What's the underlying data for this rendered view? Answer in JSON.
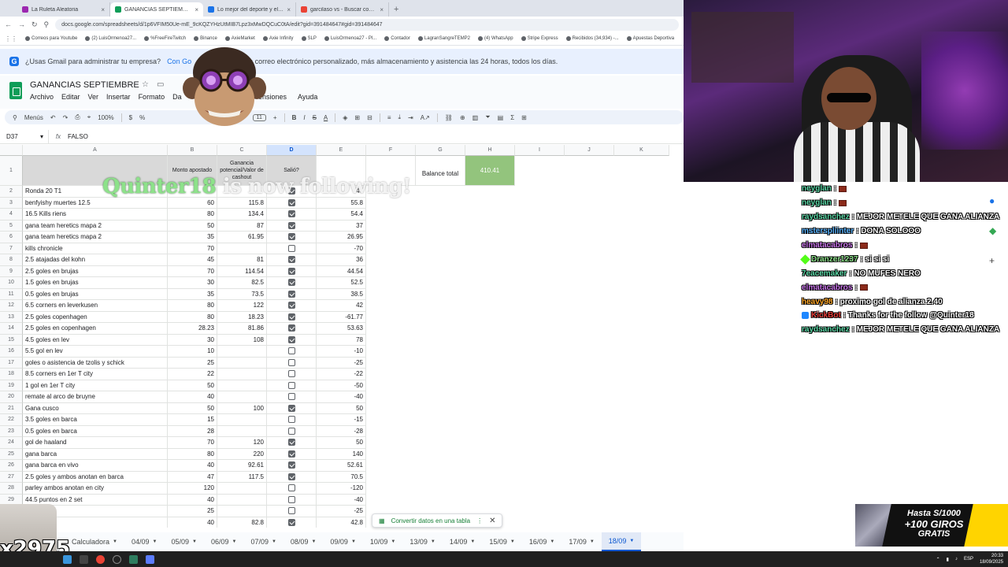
{
  "browser": {
    "tabs": [
      {
        "title": "La Ruleta Aleatoria",
        "color": "#9c27b0",
        "active": false
      },
      {
        "title": "GANANCIAS SEPTIEMBRE - Hojas",
        "color": "#0f9d58",
        "active": true
      },
      {
        "title": "Lo mejor del deporte y el entre",
        "color": "#1a73e8",
        "active": false
      },
      {
        "title": "garcilaso vs - Buscar con Goog",
        "color": "#ea4335",
        "active": false
      }
    ],
    "url": "docs.google.com/spreadsheets/d/1p6VFIM50Ue-mE_9cKQZYHzUtMIB7Lpz3xMwDQCuC0tA/edit?gid=391484647#gid=391484647",
    "bookmarks": [
      "Correos para Youtube",
      "(2) LuisOrmenoa27...",
      "%FreeFireTwitch",
      "Binance",
      "AxieMarket",
      "Axie Infinity",
      "SLP",
      "LuisOrmenoa27 - Pl...",
      "Contador",
      "LagranSangreTEMP2",
      "(4) WhatsApp",
      "Stripe Express",
      "Recibidos (34,934) -...",
      "Apuestas Deportiva"
    ]
  },
  "banner": {
    "icon": "G",
    "text": "¿Usas Gmail para administrar tu empresa?",
    "link": "Con Go",
    "rest": "un correo electrónico personalizado, más almacenamiento y asistencia las 24 horas, todos los días."
  },
  "sheet": {
    "title": "GANANCIAS SEPTIEMBRE",
    "menus": [
      "Archivo",
      "Editar",
      "Ver",
      "Insertar",
      "Formato",
      "Da"
    ],
    "menu_ext": "ensiones",
    "menu_help": "Ayuda",
    "toolbar": {
      "menus": "Menús",
      "zoom": "100%",
      "currency": "$",
      "percent": "%",
      "font": "Calibri",
      "size": "11"
    },
    "namebox": "D37",
    "formula": "FALSO",
    "columns": [
      "A",
      "B",
      "C",
      "D",
      "E",
      "F",
      "G",
      "H",
      "I",
      "J",
      "K"
    ],
    "header_row": {
      "a": "",
      "b": "Monto apostado",
      "c": "Ganancia potencial/Valor de cashout",
      "d": "Salió?",
      "g": "Balance total",
      "h": "410.41"
    },
    "rows": [
      {
        "n": "2",
        "a": "Ronda 20 T1",
        "b": "",
        "c": "",
        "d": true,
        "e": "48"
      },
      {
        "n": "3",
        "a": "benfyishy muertes 12.5",
        "b": "60",
        "c": "115.8",
        "d": true,
        "e": "55.8"
      },
      {
        "n": "4",
        "a": "16.5 Kills riens",
        "b": "80",
        "c": "134.4",
        "d": true,
        "e": "54.4"
      },
      {
        "n": "5",
        "a": "gana team heretics mapa 2",
        "b": "50",
        "c": "87",
        "d": true,
        "e": "37"
      },
      {
        "n": "6",
        "a": "gana team heretics mapa 2",
        "b": "35",
        "c": "61.95",
        "d": true,
        "e": "26.95"
      },
      {
        "n": "7",
        "a": "kills chronicle",
        "b": "70",
        "c": "",
        "d": false,
        "e": "-70"
      },
      {
        "n": "8",
        "a": "2.5 atajadas del kohn",
        "b": "45",
        "c": "81",
        "d": true,
        "e": "36"
      },
      {
        "n": "9",
        "a": "2.5 goles en brujas",
        "b": "70",
        "c": "114.54",
        "d": true,
        "e": "44.54"
      },
      {
        "n": "10",
        "a": "1.5 goles en brujas",
        "b": "30",
        "c": "82.5",
        "d": true,
        "e": "52.5"
      },
      {
        "n": "11",
        "a": "0.5 goles en brujas",
        "b": "35",
        "c": "73.5",
        "d": true,
        "e": "38.5"
      },
      {
        "n": "12",
        "a": "6.5 corners en leverkusen",
        "b": "80",
        "c": "122",
        "d": true,
        "e": "42"
      },
      {
        "n": "13",
        "a": "2.5 goles copenhagen",
        "b": "80",
        "c": "18.23",
        "d": true,
        "e": "-61.77"
      },
      {
        "n": "14",
        "a": "2.5 goles en copenhagen",
        "b": "28.23",
        "c": "81.86",
        "d": true,
        "e": "53.63"
      },
      {
        "n": "15",
        "a": "4.5 goles en lev",
        "b": "30",
        "c": "108",
        "d": true,
        "e": "78"
      },
      {
        "n": "16",
        "a": "5.5 gol en lev",
        "b": "10",
        "c": "",
        "d": false,
        "e": "-10"
      },
      {
        "n": "17",
        "a": "goles o asistencia de tzolis y schick",
        "b": "25",
        "c": "",
        "d": false,
        "e": "-25"
      },
      {
        "n": "18",
        "a": "8.5 corners en 1er T city",
        "b": "22",
        "c": "",
        "d": false,
        "e": "-22"
      },
      {
        "n": "19",
        "a": "1 gol en 1er T city",
        "b": "50",
        "c": "",
        "d": false,
        "e": "-50"
      },
      {
        "n": "20",
        "a": "remate al arco de bruyne",
        "b": "40",
        "c": "",
        "d": false,
        "e": "-40"
      },
      {
        "n": "21",
        "a": "Gana cusco",
        "b": "50",
        "c": "100",
        "d": true,
        "e": "50"
      },
      {
        "n": "22",
        "a": "3.5 goles en barca",
        "b": "15",
        "c": "",
        "d": false,
        "e": "-15"
      },
      {
        "n": "23",
        "a": "0.5 goles en barca",
        "b": "28",
        "c": "",
        "d": false,
        "e": "-28"
      },
      {
        "n": "24",
        "a": "gol de haaland",
        "b": "70",
        "c": "120",
        "d": true,
        "e": "50"
      },
      {
        "n": "25",
        "a": "gana barca",
        "b": "80",
        "c": "220",
        "d": true,
        "e": "140"
      },
      {
        "n": "26",
        "a": "gana barca en vivo",
        "b": "40",
        "c": "92.61",
        "d": true,
        "e": "52.61"
      },
      {
        "n": "27",
        "a": "2.5 goles y ambos anotan en barca",
        "b": "47",
        "c": "117.5",
        "d": true,
        "e": "70.5"
      },
      {
        "n": "28",
        "a": "parley ambos anotan en city",
        "b": "120",
        "c": "",
        "d": false,
        "e": "-120"
      },
      {
        "n": "29",
        "a": "44.5 puntos en 2 set",
        "b": "40",
        "c": "",
        "d": false,
        "e": "-40"
      },
      {
        "n": "30",
        "a": "",
        "b": "25",
        "c": "",
        "d": false,
        "e": "-25"
      },
      {
        "n": "31",
        "a": "",
        "b": "40",
        "c": "82.8",
        "d": true,
        "e": "42.8"
      }
    ],
    "toast": "Convertir datos en una tabla",
    "tabs": [
      "Calculadora",
      "04/09",
      "05/09",
      "06/09",
      "07/09",
      "08/09",
      "09/09",
      "10/09",
      "13/09",
      "14/09",
      "15/09",
      "16/09",
      "17/09",
      "18/09"
    ],
    "active_tab": "18/09"
  },
  "overlay": {
    "name": "Quinter18",
    "rest": " is now following!"
  },
  "chat": [
    {
      "user": "neyglan",
      "color": "#59d6a4",
      "msg": ":",
      "emote": true
    },
    {
      "user": "neyglan",
      "color": "#59d6a4",
      "msg": ":",
      "emote": true
    },
    {
      "user": "raydsanchez",
      "color": "#59d6a4",
      "msg": ": MEJOR METELE QUE GANA ALIANZA",
      "emote": false
    },
    {
      "user": "msterspliinter",
      "color": "#5ab4ff",
      "msg": ": DONA SOLOOO",
      "emote": false
    },
    {
      "user": "elmatacabros",
      "color": "#c774e8",
      "msg": ":",
      "emote": true
    },
    {
      "user": "Dranzer1237",
      "color": "#8de28a",
      "msg": ": si si si",
      "emote": false,
      "badge": "green"
    },
    {
      "user": "7eacemaker",
      "color": "#59d6a4",
      "msg": ": NO MUFES NERO",
      "emote": false
    },
    {
      "user": "elmatacabros",
      "color": "#c774e8",
      "msg": ":",
      "emote": true
    },
    {
      "user": "heavy98",
      "color": "#ffa726",
      "msg": ": proximo gol de alianza 2.40",
      "emote": false
    },
    {
      "user": "KickBot",
      "color": "#e53935",
      "msg": ": Thanks for the follow @Quinter18",
      "emote": false,
      "badge": "blue"
    },
    {
      "user": "raydsanchez",
      "color": "#59d6a4",
      "msg": ": MEJOR METELE QUE GANA ALIANZA",
      "emote": false
    }
  ],
  "promo": {
    "line1": "Hasta S/1000",
    "line2": "+100 GIROS",
    "line3": "GRATIS"
  },
  "catcounter": "x2975",
  "tray": {
    "lang": "ESP",
    "time": "20:33",
    "date": "18/09/2025"
  }
}
